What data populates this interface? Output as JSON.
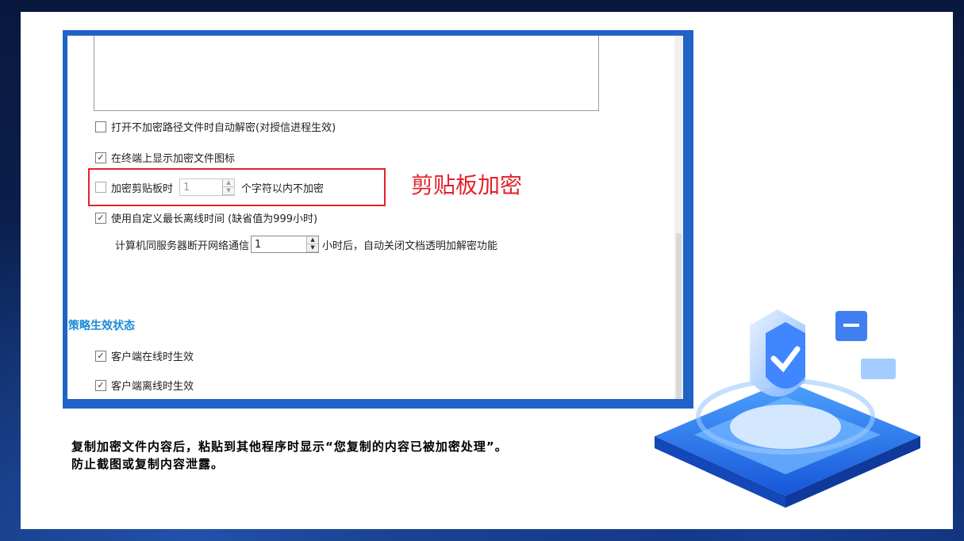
{
  "settings": {
    "decrypt_unencrypted_path": {
      "label": "打开不加密路径文件时自动解密(对授信进程生效)",
      "checked": false
    },
    "show_encrypted_icon": {
      "label": "在终端上显示加密文件图标",
      "checked": true
    },
    "clipboard_encrypt": {
      "label": "加密剪贴板时",
      "checked": false,
      "value": "1",
      "suffix": "个字符以内不加密"
    },
    "custom_offline_time": {
      "label": "使用自定义最长离线时间 (缺省值为999小时)",
      "checked": true
    },
    "disconnect": {
      "prefix": "计算机同服务器断开网络通信",
      "value": "1",
      "suffix": "小时后，自动关闭文档透明加解密功能"
    }
  },
  "annotation": "剪贴板加密",
  "policy_section": {
    "title": "策略生效状态",
    "online": {
      "label": "客户端在线时生效",
      "checked": true
    },
    "offline": {
      "label": "客户端离线时生效",
      "checked": true
    }
  },
  "caption": {
    "line1": "复制加密文件内容后，粘贴到其他程序时显示“您复制的内容已被加密处理”。",
    "line2": "防止截图或复制内容泄露。"
  },
  "colors": {
    "frame": "#1f63c7",
    "highlight": "#e3222a",
    "section": "#1c8ad6"
  },
  "icons": {
    "check": "check-icon",
    "up": "spin-up-icon",
    "down": "spin-down-icon",
    "illustration": "shield-security-illustration"
  }
}
